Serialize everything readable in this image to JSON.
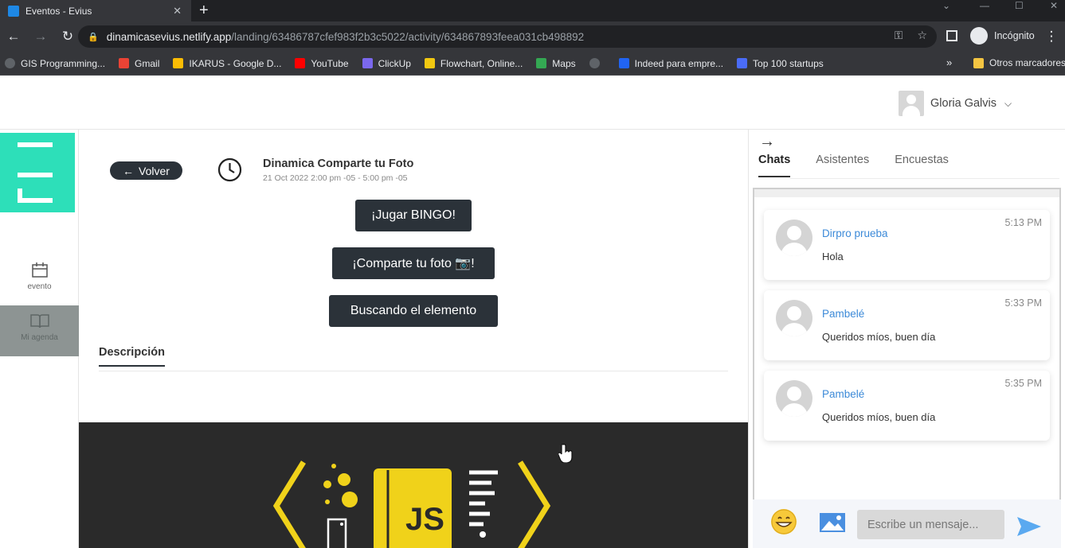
{
  "browser": {
    "tab_title": "Eventos - Evius",
    "url_host": "dinamicasevius.netlify.app",
    "url_path": "/landing/63486787cfef983f2b3c5022/activity/634867893feea031cb498892",
    "profile_label": "Incógnito",
    "bookmarks": [
      {
        "label": "GIS Programming...",
        "color": "#5f6368"
      },
      {
        "label": "Gmail",
        "color": "#ea4335"
      },
      {
        "label": "IKARUS - Google D...",
        "color": "#fbbc04"
      },
      {
        "label": "YouTube",
        "color": "#ff0000"
      },
      {
        "label": "ClickUp",
        "color": "#7b68ee"
      },
      {
        "label": "Flowchart, Online...",
        "color": "#f2c811"
      },
      {
        "label": "Maps",
        "color": "#34a853"
      },
      {
        "label": "",
        "color": "#5f6368"
      },
      {
        "label": "Indeed para empre...",
        "color": "#2164f3"
      },
      {
        "label": "Top 100 startups",
        "color": "#4a6cf7"
      }
    ],
    "other_bookmarks": "Otros marcadores",
    "more": "»"
  },
  "header": {
    "user_name": "Gloria Galvis"
  },
  "sidebar": {
    "items": [
      {
        "label": "evento"
      },
      {
        "label": "Mi agenda"
      }
    ]
  },
  "activity": {
    "back_label": "Volver",
    "title": "Dinamica Comparte tu Foto",
    "date": "21 Oct 2022 2:00 pm -05 - 5:00 pm -05",
    "buttons": [
      {
        "label": "¡Jugar BINGO!"
      },
      {
        "label": "¡Comparte tu foto 📷!"
      },
      {
        "label": "Buscando el elemento"
      }
    ],
    "description_tab": "Descripción",
    "banner_text": "JS"
  },
  "chat": {
    "tabs": [
      {
        "label": "Chats",
        "active": true
      },
      {
        "label": "Asistentes",
        "active": false
      },
      {
        "label": "Encuestas",
        "active": false
      }
    ],
    "messages": [
      {
        "name": "Dirpro prueba",
        "text": "Hola",
        "time": "5:13 PM"
      },
      {
        "name": "Pambelé",
        "text": "Queridos míos, buen día",
        "time": "5:33 PM"
      },
      {
        "name": "Pambelé",
        "text": "Queridos míos, buen día",
        "time": "5:35 PM"
      }
    ],
    "input_placeholder": "Escribe un mensaje..."
  },
  "colors": {
    "accent": "#2ddfb9",
    "dark_button": "#2b3239",
    "chat_name": "#3c8ad8",
    "send": "#5aa9f0"
  }
}
